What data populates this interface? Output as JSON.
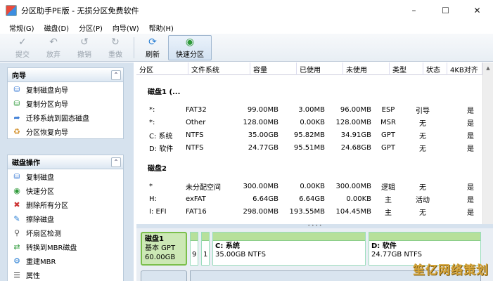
{
  "window": {
    "title": "分区助手PE版 - 无损分区免费软件"
  },
  "menu": [
    "常规(G)",
    "磁盘(D)",
    "分区(P)",
    "向导(W)",
    "帮助(H)"
  ],
  "toolbar": {
    "commit": "提交",
    "discard": "放弃",
    "undo": "撤销",
    "redo": "重做",
    "refresh": "刷新",
    "quick_partition": "快速分区"
  },
  "wizard": {
    "title": "向导",
    "items": [
      "复制磁盘向导",
      "复制分区向导",
      "迁移系统到固态磁盘",
      "分区恢复向导"
    ]
  },
  "disk_ops": {
    "title": "磁盘操作",
    "items": [
      "复制磁盘",
      "快速分区",
      "删除所有分区",
      "擦除磁盘",
      "坏扇区检测",
      "转换到MBR磁盘",
      "重建MBR",
      "属性"
    ]
  },
  "columns": [
    "分区",
    "文件系统",
    "容量",
    "已使用",
    "未使用",
    "类型",
    "状态",
    "4KB对齐"
  ],
  "disks": [
    {
      "label": "磁盘1 (...",
      "rows": [
        [
          "*:",
          "FAT32",
          "99.00MB",
          "3.00MB",
          "96.00MB",
          "ESP",
          "引导",
          "是"
        ],
        [
          "*:",
          "Other",
          "128.00MB",
          "0.00KB",
          "128.00MB",
          "MSR",
          "无",
          "是"
        ],
        [
          "C: 系统",
          "NTFS",
          "35.00GB",
          "95.82MB",
          "34.91GB",
          "GPT",
          "无",
          "是"
        ],
        [
          "D: 软件",
          "NTFS",
          "24.77GB",
          "95.51MB",
          "24.68GB",
          "GPT",
          "无",
          "是"
        ]
      ]
    },
    {
      "label": "磁盘2",
      "rows": [
        [
          "*",
          "未分配空间",
          "300.00MB",
          "0.00KB",
          "300.00MB",
          "逻辑",
          "无",
          "是"
        ],
        [
          "H:",
          "exFAT",
          "6.64GB",
          "6.64GB",
          "0.00KB",
          "主",
          "活动",
          "是"
        ],
        [
          "I: EFI",
          "FAT16",
          "298.00MB",
          "193.55MB",
          "104.45MB",
          "主",
          "无",
          "是"
        ]
      ]
    }
  ],
  "diskmap": {
    "disk1": {
      "name": "磁盘1",
      "style": "基本 GPT",
      "size": "60.00GB"
    },
    "small_parts": [
      "9",
      "1"
    ],
    "c": {
      "title": "C: 系统",
      "detail": "35.00GB NTFS"
    },
    "d": {
      "title": "D: 软件",
      "detail": "24.77GB NTFS"
    }
  },
  "watermark": "笙亿网络策划"
}
